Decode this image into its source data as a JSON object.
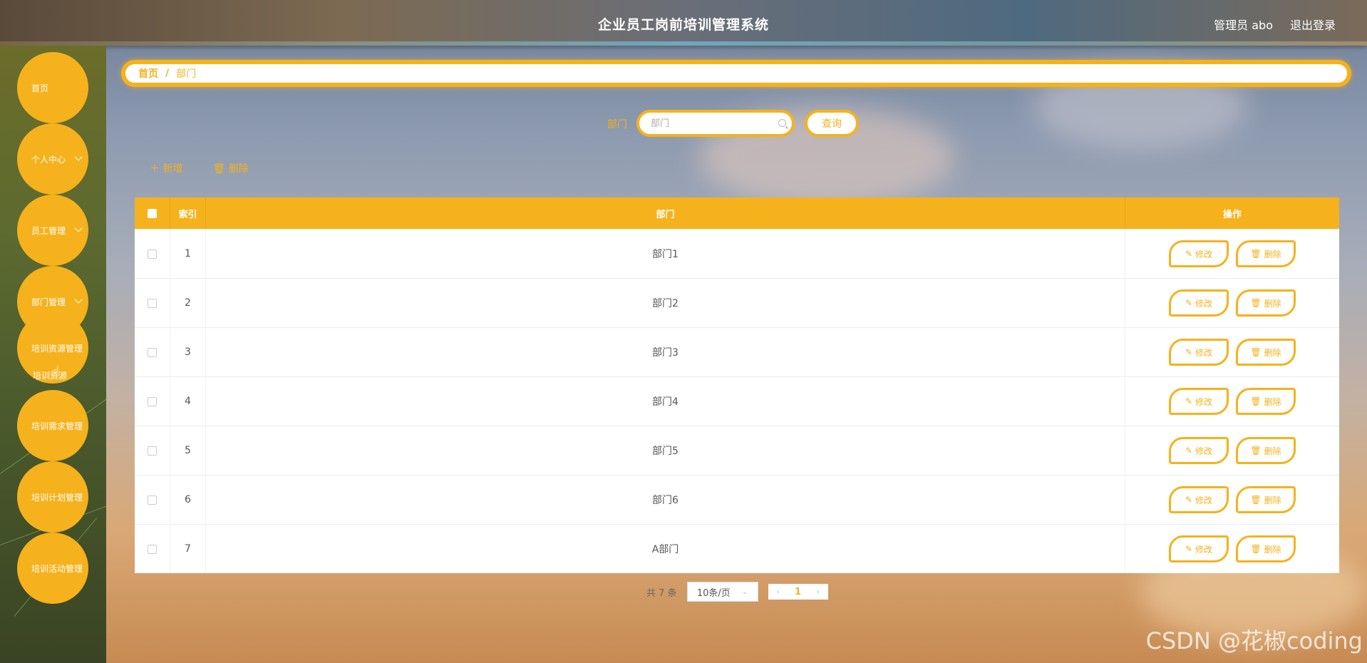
{
  "header": {
    "title": "企业员工岗前培训管理系统",
    "user": "管理员 abo",
    "logout": "退出登录"
  },
  "sidebar": {
    "items": [
      {
        "label": "首页",
        "has_children": false
      },
      {
        "label": "个人中心",
        "has_children": true
      },
      {
        "label": "员工管理",
        "has_children": true
      },
      {
        "label": "部门管理",
        "has_children": true
      },
      {
        "label": "培训资源管理",
        "has_children": false
      },
      {
        "label": "培训需求管理",
        "has_children": false
      },
      {
        "label": "培训计划管理",
        "has_children": false
      },
      {
        "label": "培训活动管理",
        "has_children": false
      }
    ],
    "submenu_label": "培训资源"
  },
  "breadcrumb": {
    "home": "首页",
    "separator": "/",
    "current": "部门"
  },
  "search": {
    "label": "部门",
    "placeholder": "部门",
    "value": "",
    "button": "查询"
  },
  "actions": {
    "add": "新增",
    "delete": "删除"
  },
  "table": {
    "headers": {
      "index": "索引",
      "dept": "部门",
      "ops": "操作"
    },
    "rows": [
      {
        "index": "1",
        "dept": "部门1"
      },
      {
        "index": "2",
        "dept": "部门2"
      },
      {
        "index": "3",
        "dept": "部门3"
      },
      {
        "index": "4",
        "dept": "部门4"
      },
      {
        "index": "5",
        "dept": "部门5"
      },
      {
        "index": "6",
        "dept": "部门6"
      },
      {
        "index": "7",
        "dept": "A部门"
      }
    ],
    "row_edit_label": "修改",
    "row_delete_label": "删除"
  },
  "pagination": {
    "total": "共 7 条",
    "page_size": "10条/页",
    "current_page": "1"
  },
  "watermark": "CSDN @花椒coding",
  "colors": {
    "accent": "#f5b21c"
  },
  "icons": {
    "add": "plus-icon",
    "delete": "trash-icon",
    "edit": "pencil-icon",
    "search": "search-icon"
  }
}
